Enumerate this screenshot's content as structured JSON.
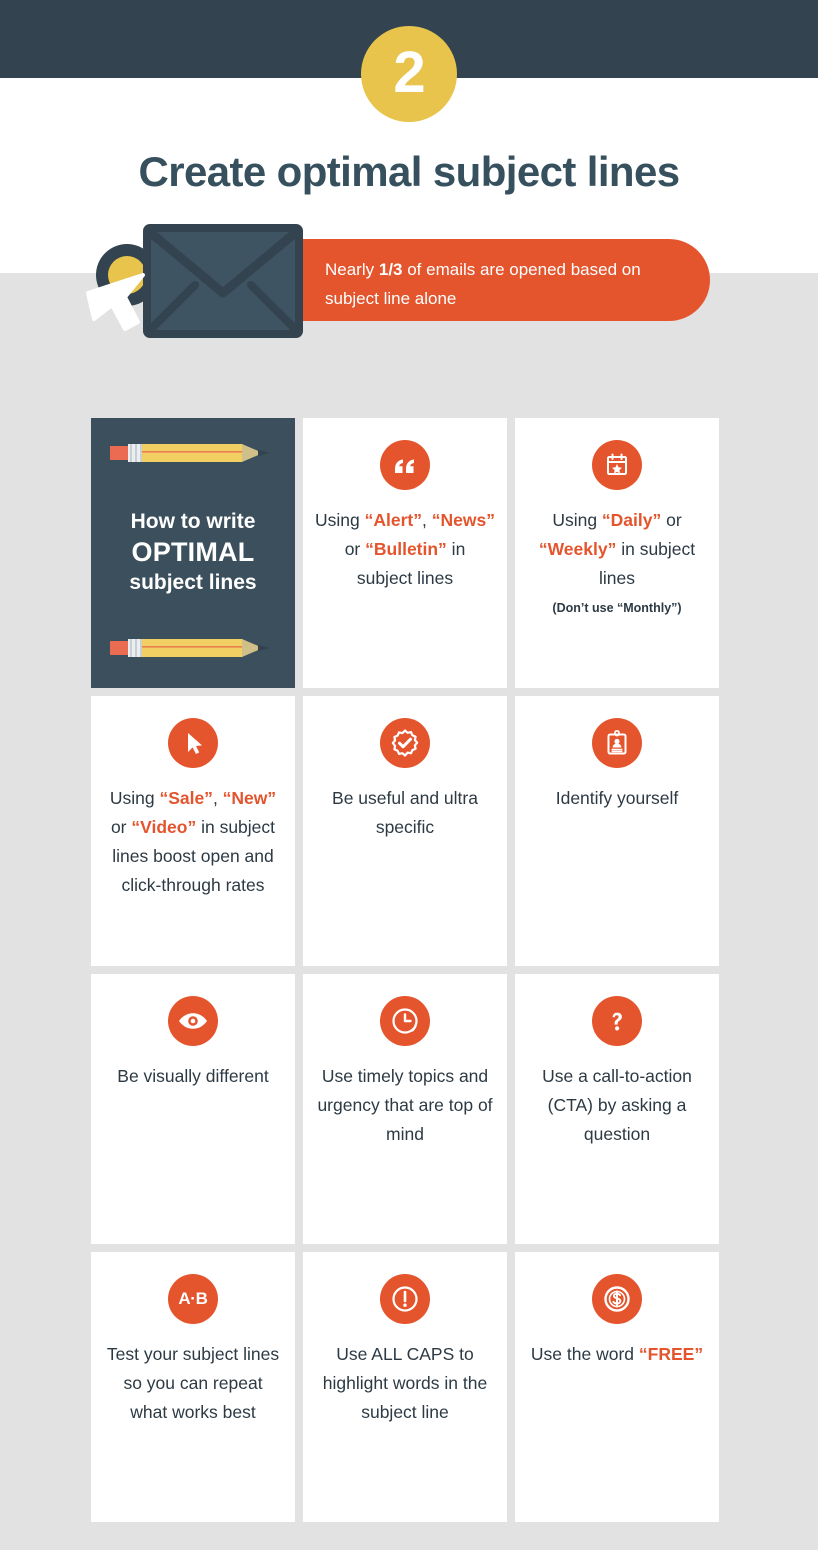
{
  "colors": {
    "header_dark": "#33434f",
    "page_gray": "#e2e2e2",
    "accent_orange": "#e4552e",
    "badge_yellow": "#e8c44c",
    "title_slate": "#36505e",
    "card_dark": "#3b4f5c"
  },
  "header": {
    "step_number": "2",
    "title": "Create optimal subject lines"
  },
  "stat_banner": {
    "prefix": "Nearly ",
    "emphasis": "1/3",
    "suffix": " of emails are opened based on subject line alone",
    "full_text": "Nearly 1/3 of emails are opened based on subject line alone"
  },
  "promo_card": {
    "line1": "How to write",
    "line2": "OPTIMAL",
    "line3": "subject lines",
    "icon_top": "pencil-icon",
    "icon_bottom": "pencil-icon"
  },
  "cards": [
    {
      "icon": "quote-icon",
      "segments": [
        {
          "text": "Using ",
          "style": "normal"
        },
        {
          "text": "“Alert”",
          "style": "highlight"
        },
        {
          "text": ", ",
          "style": "normal"
        },
        {
          "text": "“News”",
          "style": "highlight"
        },
        {
          "text": " or ",
          "style": "normal"
        },
        {
          "text": "“Bulletin”",
          "style": "highlight"
        },
        {
          "text": " in subject lines",
          "style": "normal"
        }
      ],
      "plain_text": "Using “Alert”, “News” or “Bulletin” in subject lines",
      "note": ""
    },
    {
      "icon": "calendar-star-icon",
      "segments": [
        {
          "text": "Using ",
          "style": "normal"
        },
        {
          "text": "“Daily”",
          "style": "highlight"
        },
        {
          "text": " or ",
          "style": "normal"
        },
        {
          "text": "“Weekly”",
          "style": "highlight"
        },
        {
          "text": " in subject lines",
          "style": "normal"
        }
      ],
      "plain_text": "Using “Daily” or “Weekly” in subject lines",
      "note": "(Don’t use “Monthly”)"
    },
    {
      "icon": "cursor-arrow-icon",
      "segments": [
        {
          "text": "Using ",
          "style": "normal"
        },
        {
          "text": "“Sale”",
          "style": "highlight"
        },
        {
          "text": ", ",
          "style": "normal"
        },
        {
          "text": "“New”",
          "style": "highlight"
        },
        {
          "text": " or ",
          "style": "normal"
        },
        {
          "text": "“Video”",
          "style": "highlight"
        },
        {
          "text": " in subject lines boost open and click-through rates",
          "style": "normal"
        }
      ],
      "plain_text": "Using “Sale”, “New” or “Video” in subject lines boost open and click-through rates",
      "note": ""
    },
    {
      "icon": "check-badge-icon",
      "segments": [
        {
          "text": "Be useful and ultra specific",
          "style": "normal"
        }
      ],
      "plain_text": "Be useful and ultra specific",
      "note": ""
    },
    {
      "icon": "id-card-icon",
      "segments": [
        {
          "text": "Identify yourself",
          "style": "normal"
        }
      ],
      "plain_text": "Identify yourself",
      "note": ""
    },
    {
      "icon": "eye-icon",
      "segments": [
        {
          "text": "Be visually different",
          "style": "normal"
        }
      ],
      "plain_text": "Be visually different",
      "note": ""
    },
    {
      "icon": "clock-icon",
      "segments": [
        {
          "text": "Use timely topics and urgency that are top of mind",
          "style": "normal"
        }
      ],
      "plain_text": "Use timely topics and urgency that are top of mind",
      "note": ""
    },
    {
      "icon": "question-mark-icon",
      "segments": [
        {
          "text": "Use a call-to-action (CTA) by asking a question",
          "style": "normal"
        }
      ],
      "plain_text": "Use a call-to-action (CTA) by asking a question",
      "note": ""
    },
    {
      "icon": "ab-test-icon",
      "segments": [
        {
          "text": "Test your subject lines so you can repeat what works best",
          "style": "normal"
        }
      ],
      "plain_text": "Test your subject lines so you can repeat what works best",
      "note": ""
    },
    {
      "icon": "exclamation-icon",
      "segments": [
        {
          "text": "Use ALL CAPS to highlight words in the subject line",
          "style": "normal"
        }
      ],
      "plain_text": "Use ALL CAPS to highlight words in the subject line",
      "note": ""
    },
    {
      "icon": "money-icon",
      "segments": [
        {
          "text": "Use the word ",
          "style": "normal"
        },
        {
          "text": "“FREE”",
          "style": "free"
        }
      ],
      "plain_text": "Use the word “FREE”",
      "note": ""
    }
  ],
  "ab_icon_label": "A·B"
}
